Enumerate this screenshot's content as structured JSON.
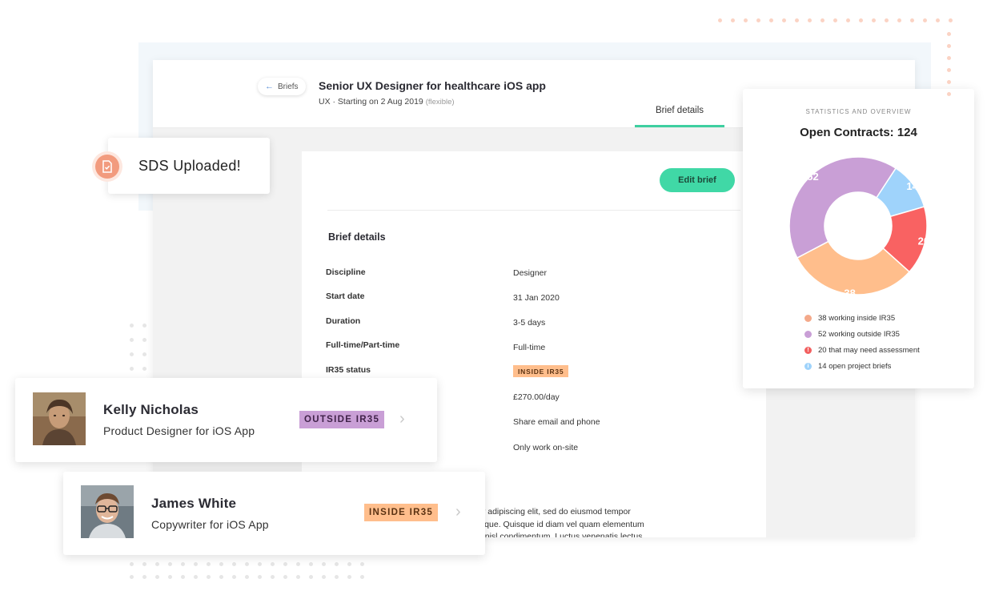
{
  "brief": {
    "back_label": "Briefs",
    "title": "Senior UX Designer for healthcare iOS app",
    "discipline_tag": "UX",
    "start_meta": "· Starting on 2 Aug 2019",
    "start_flex": "(flexible)",
    "active_tab": "Brief details",
    "edit_button": "Edit brief",
    "section_title": "Brief details",
    "rows": [
      {
        "label": "Discipline",
        "value": "Designer"
      },
      {
        "label": "Start date",
        "value": "31 Jan 2020"
      },
      {
        "label": "Duration",
        "value": "3-5 days"
      },
      {
        "label": "Full-time/Part-time",
        "value": "Full-time"
      },
      {
        "label": "IR35 status",
        "value": "INSIDE IR35"
      }
    ],
    "extra_values": [
      "£270.00/day",
      "Share email and phone",
      "Only work on-site"
    ],
    "lorem_lines": [
      "ur adipiscing elit, sed do eiusmod tempor",
      "uique. Quisque id diam vel quam elementum",
      "h nisl condimentum. Luctus venenatis lectus"
    ]
  },
  "notification": {
    "text": "SDS Uploaded!",
    "icon": "document-check-icon"
  },
  "people": [
    {
      "name": "Kelly Nicholas",
      "role": "Product Designer for iOS App",
      "badge": "OUTSIDE IR35",
      "badge_color": "#c99fd6"
    },
    {
      "name": "James White",
      "role": "Copywriter for iOS App",
      "badge": "INSIDE IR35",
      "badge_color": "#ffbe8c"
    }
  ],
  "stats": {
    "caption": "STATISTICS AND OVERVIEW",
    "title": "Open Contracts: 124",
    "legend": [
      {
        "text": "38 working inside IR35",
        "color": "#f4a98a"
      },
      {
        "text": "52 working outside IR35",
        "color": "#c99fd6"
      },
      {
        "text": "20 that may need assessment",
        "color": "#f26060"
      },
      {
        "text": "14 open project briefs",
        "color": "#9fd3fb"
      }
    ]
  },
  "chart_data": {
    "type": "pie",
    "title": "Open Contracts: 124",
    "categories": [
      "working outside IR35",
      "open project briefs",
      "that may need assessment",
      "working inside IR35"
    ],
    "values": [
      52,
      14,
      20,
      38
    ],
    "colors": [
      "#c99fd6",
      "#9fd3fb",
      "#f96262",
      "#ffbe8c"
    ]
  }
}
